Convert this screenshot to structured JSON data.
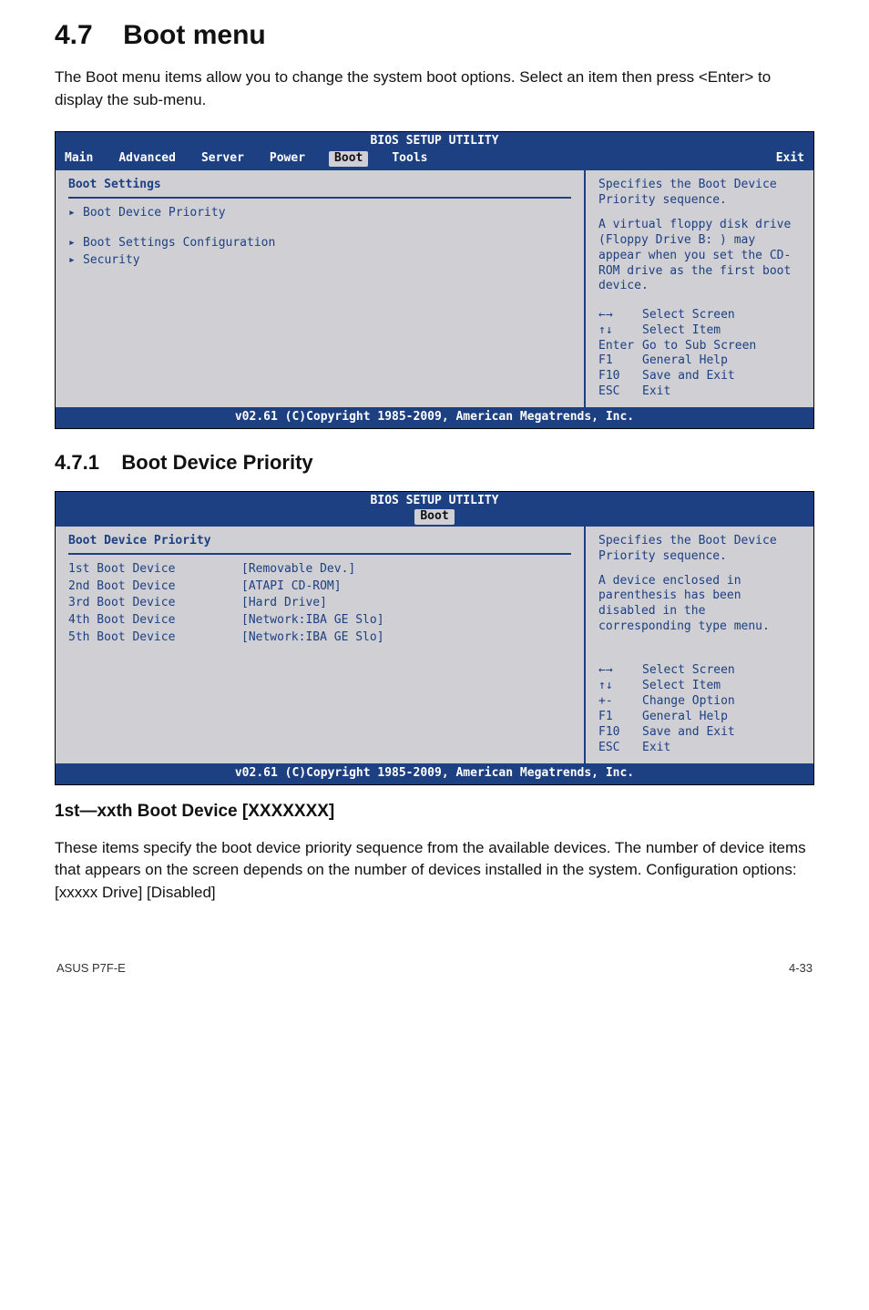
{
  "heading": {
    "num": "4.7",
    "title": "Boot menu"
  },
  "intro": "The Boot menu items allow you to change the system boot options. Select an item then press <Enter> to display the sub-menu.",
  "sub1": {
    "num": "4.7.1",
    "title": "Boot Device Priority"
  },
  "sub2": "1st—xxth Boot Device [XXXXXXX]",
  "body": "These items specify the boot device priority sequence from the available devices. The number of device items that appears on the screen depends on the number of devices installed in the system. Configuration options: [xxxxx Drive] [Disabled]",
  "bios1": {
    "header": "BIOS SETUP UTILITY",
    "tabs": {
      "0": "Main",
      "1": "Advanced",
      "2": "Server",
      "3": "Power",
      "4": "Boot",
      "5": "Tools",
      "6": "Exit"
    },
    "left_title": "Boot Settings",
    "rows": {
      "0": "Boot Device Priority",
      "1": "Boot Settings Configuration",
      "2": "Security"
    },
    "help1": "Specifies the Boot Device Priority sequence.",
    "help2": "A virtual floppy disk drive (Floppy Drive B: ) may appear when you set the CD-ROM drive as the first boot device.",
    "nav": {
      "l0k": "←→",
      "l0v": "Select Screen",
      "l1k": "↑↓",
      "l1v": "Select Item",
      "l2k": "Enter",
      "l2v": "Go to Sub Screen",
      "l3k": "F1",
      "l3v": "General Help",
      "l4k": "F10",
      "l4v": "Save and Exit",
      "l5k": "ESC",
      "l5v": "Exit"
    },
    "footer": "v02.61 (C)Copyright 1985-2009, American Megatrends, Inc."
  },
  "bios2": {
    "header": "BIOS SETUP UTILITY",
    "tab": "Boot",
    "left_title": "Boot Device Priority",
    "rows": {
      "0": {
        "lbl": "1st Boot Device",
        "val": "[Removable Dev.]"
      },
      "1": {
        "lbl": "2nd Boot Device",
        "val": "[ATAPI CD-ROM]"
      },
      "2": {
        "lbl": "3rd Boot Device",
        "val": "[Hard Drive]"
      },
      "3": {
        "lbl": "4th Boot Device",
        "val": "[Network:IBA GE Slo]"
      },
      "4": {
        "lbl": "5th Boot Device",
        "val": "[Network:IBA GE Slo]"
      }
    },
    "help1": "Specifies the Boot Device Priority sequence.",
    "help2": "A device enclosed in parenthesis has been disabled in the corresponding type menu.",
    "nav": {
      "l0k": "←→",
      "l0v": "Select Screen",
      "l1k": "↑↓",
      "l1v": "Select Item",
      "l2k": "+-",
      "l2v": "Change Option",
      "l3k": "F1",
      "l3v": "General Help",
      "l4k": "F10",
      "l4v": "Save and Exit",
      "l5k": "ESC",
      "l5v": "Exit"
    },
    "footer": "v02.61 (C)Copyright 1985-2009, American Megatrends, Inc."
  },
  "footer": {
    "left": "ASUS P7F-E",
    "right": "4-33"
  }
}
